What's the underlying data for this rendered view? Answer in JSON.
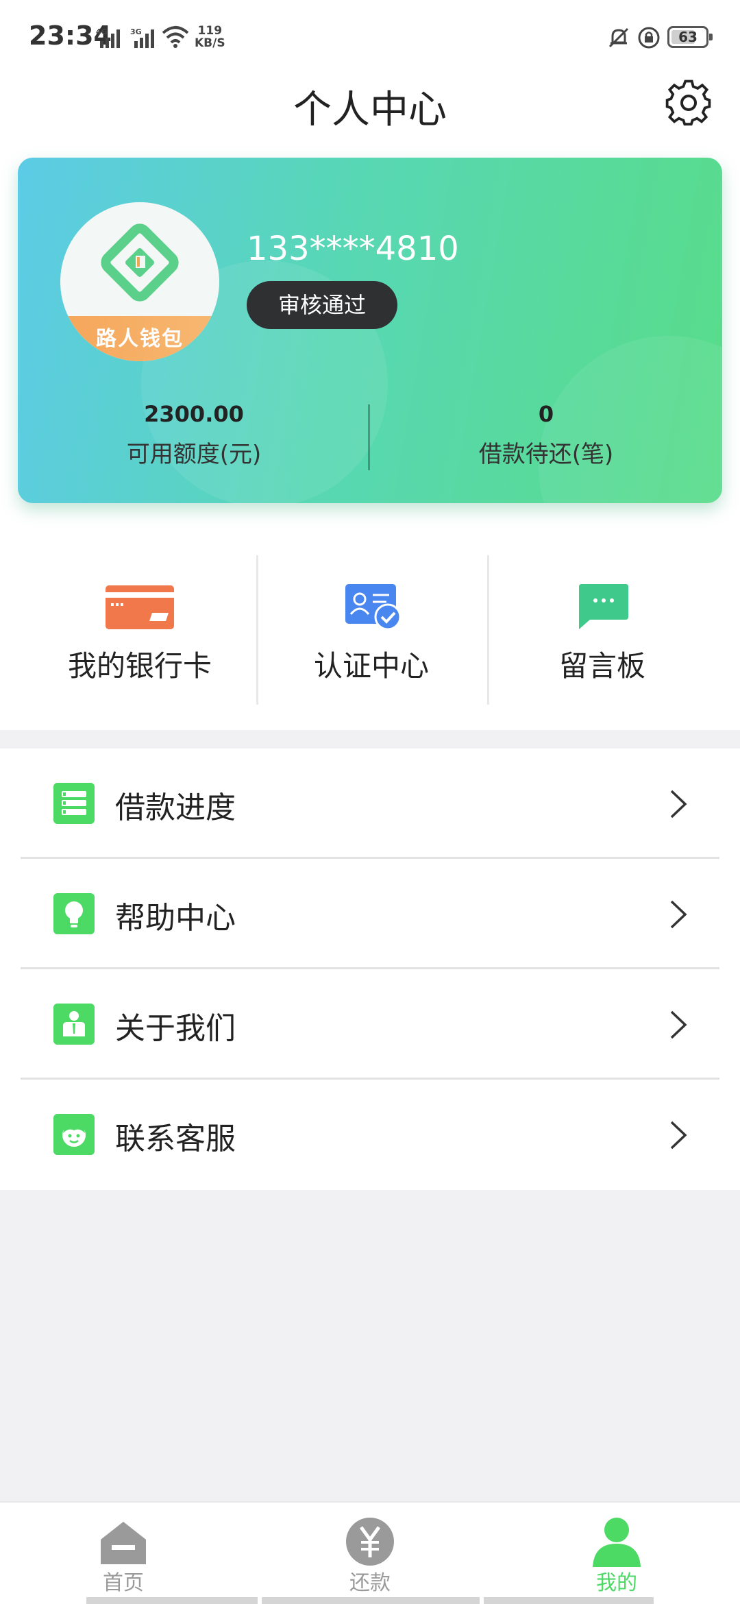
{
  "status_bar": {
    "time": "23:34",
    "network1": "4G",
    "network2": "3G",
    "speed_value": "119",
    "speed_unit": "KB/S",
    "battery": "63"
  },
  "header": {
    "title": "个人中心"
  },
  "profile": {
    "brand": "路人钱包",
    "phone": "133****4810",
    "status": "审核通过",
    "available_credit": "2300.00",
    "available_credit_label": "可用额度(元)",
    "pending_loans": "0",
    "pending_loans_label": "借款待还(笔)"
  },
  "quick_actions": [
    {
      "label": "我的银行卡",
      "icon": "bank-card-icon",
      "color": "#f0784a"
    },
    {
      "label": "认证中心",
      "icon": "certification-icon",
      "color": "#4a86f0"
    },
    {
      "label": "留言板",
      "icon": "message-board-icon",
      "color": "#3fc98a"
    }
  ],
  "menu": [
    {
      "label": "借款进度",
      "icon": "loan-progress-icon"
    },
    {
      "label": "帮助中心",
      "icon": "lightbulb-icon"
    },
    {
      "label": "关于我们",
      "icon": "about-person-icon"
    },
    {
      "label": "联系客服",
      "icon": "customer-service-icon"
    }
  ],
  "tabs": [
    {
      "label": "首页",
      "icon": "home-icon"
    },
    {
      "label": "还款",
      "icon": "yuan-icon"
    },
    {
      "label": "我的",
      "icon": "user-icon"
    }
  ],
  "colors": {
    "accent_green": "#4cd964",
    "card_gradient_start": "#5ccbe6",
    "card_gradient_end": "#58dc89"
  }
}
